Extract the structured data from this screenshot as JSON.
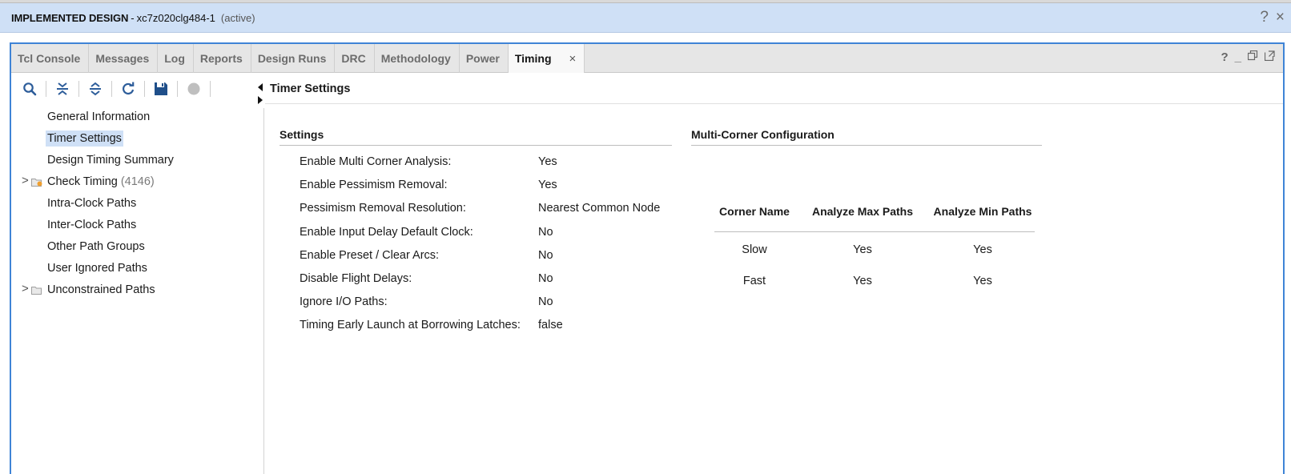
{
  "window": {
    "design_label": "IMPLEMENTED DESIGN",
    "separator": "-",
    "part": "xc7z020clg484-1",
    "status": "(active)",
    "help_symbol": "?",
    "close_symbol": "×"
  },
  "tabs": [
    {
      "label": "Tcl Console"
    },
    {
      "label": "Messages"
    },
    {
      "label": "Log"
    },
    {
      "label": "Reports"
    },
    {
      "label": "Design Runs"
    },
    {
      "label": "DRC"
    },
    {
      "label": "Methodology"
    },
    {
      "label": "Power"
    },
    {
      "label": "Timing",
      "active": true,
      "close_symbol": "×"
    }
  ],
  "tab_controls": {
    "help": "?",
    "minimize": "_"
  },
  "toolbar": {
    "icons": [
      "search-icon",
      "collapse-all-icon",
      "expand-all-icon",
      "refresh-icon",
      "save-icon",
      "stop-icon"
    ]
  },
  "tree": {
    "items": [
      {
        "label": "General Information"
      },
      {
        "label": "Timer Settings",
        "selected": true
      },
      {
        "label": "Design Timing Summary"
      },
      {
        "label": "Check Timing",
        "count": "(4146)",
        "expandable": true
      },
      {
        "label": "Intra-Clock Paths"
      },
      {
        "label": "Inter-Clock Paths"
      },
      {
        "label": "Other Path Groups"
      },
      {
        "label": "User Ignored Paths"
      },
      {
        "label": "Unconstrained Paths",
        "expandable": true
      }
    ],
    "expander_symbol": ">"
  },
  "detail": {
    "title": "Timer Settings",
    "settings_title": "Settings",
    "settings": [
      {
        "label": "Enable Multi Corner Analysis:",
        "value": "Yes"
      },
      {
        "label": "Enable Pessimism Removal:",
        "value": "Yes"
      },
      {
        "label": "Pessimism Removal Resolution:",
        "value": "Nearest Common Node"
      },
      {
        "label": "Enable Input Delay Default Clock:",
        "value": "No"
      },
      {
        "label": "Enable Preset / Clear Arcs:",
        "value": "No"
      },
      {
        "label": "Disable Flight Delays:",
        "value": "No"
      },
      {
        "label": "Ignore I/O Paths:",
        "value": "No"
      },
      {
        "label": "Timing Early Launch at Borrowing Latches:",
        "value": "false"
      }
    ],
    "multicorner_title": "Multi-Corner Configuration",
    "multicorner": {
      "headers": [
        "Corner Name",
        "Analyze Max Paths",
        "Analyze Min Paths"
      ],
      "rows": [
        [
          "Slow",
          "Yes",
          "Yes"
        ],
        [
          "Fast",
          "Yes",
          "Yes"
        ]
      ]
    }
  },
  "colors": {
    "title_bar_bg": "#cfe0f6",
    "panel_border": "#3f84d6",
    "selection_bg": "#cfe0f6",
    "folder_badge": "#f0a030"
  }
}
